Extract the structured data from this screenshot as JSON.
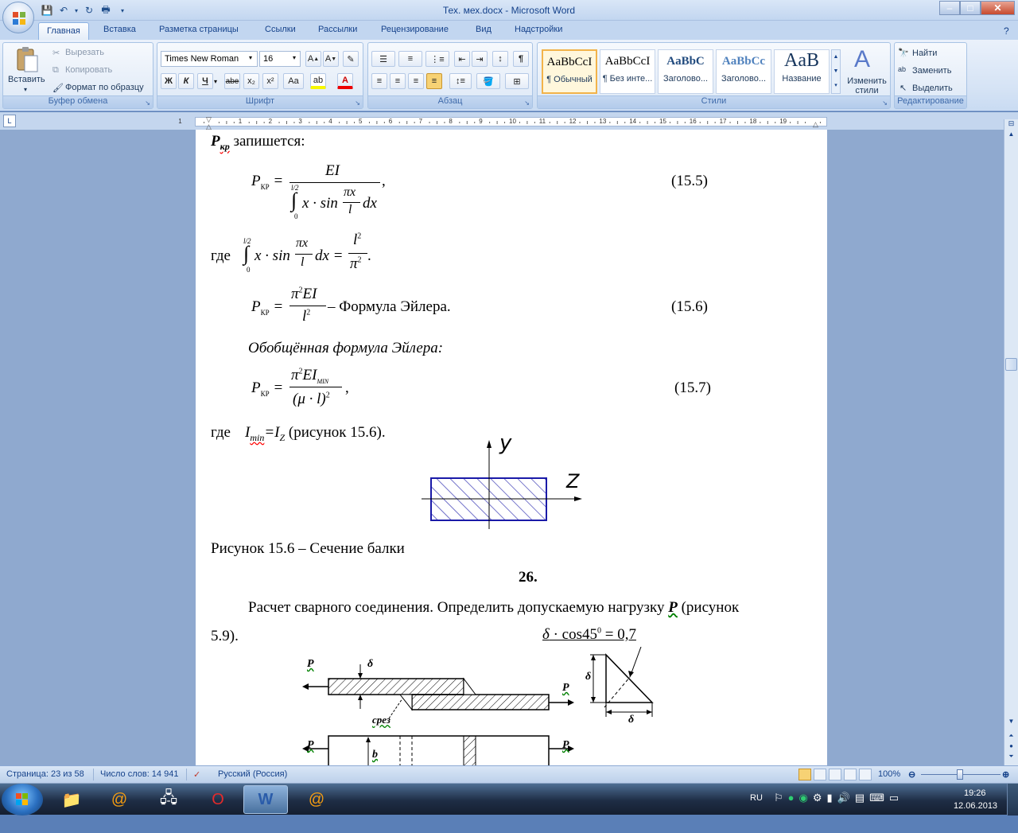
{
  "window": {
    "title": "Тех. мех.docx - Microsoft Word"
  },
  "tabs": [
    "Главная",
    "Вставка",
    "Разметка страницы",
    "Ссылки",
    "Рассылки",
    "Рецензирование",
    "Вид",
    "Надстройки"
  ],
  "ribbon": {
    "clipboard": {
      "label": "Буфер обмена",
      "paste": "Вставить",
      "cut": "Вырезать",
      "copy": "Копировать",
      "format_painter": "Формат по образцу"
    },
    "font": {
      "label": "Шрифт",
      "family": "Times New Roman",
      "size": "16",
      "bold": "Ж",
      "italic": "К",
      "underline": "Ч",
      "strike": "abe",
      "sub": "x₂",
      "sup": "x²",
      "case": "Aa"
    },
    "paragraph": {
      "label": "Абзац",
      "pilcrow": "¶"
    },
    "styles": {
      "label": "Стили",
      "items": [
        {
          "sample": "AaBbCcI",
          "name": "¶ Обычный"
        },
        {
          "sample": "AaBbCcI",
          "name": "¶ Без инте..."
        },
        {
          "sample": "AaBbC",
          "name": "Заголово..."
        },
        {
          "sample": "AaBbCc",
          "name": "Заголово..."
        },
        {
          "sample": "AaB",
          "name": "Название"
        }
      ],
      "change_styles": "Изменить стили"
    },
    "editing": {
      "label": "Редактирование",
      "find": "Найти",
      "replace": "Заменить",
      "select": "Выделить"
    }
  },
  "ruler": {
    "numbers": [
      "1",
      "1",
      "2",
      "3",
      "4",
      "5",
      "6",
      "7",
      "8",
      "9",
      "10",
      "11",
      "12",
      "13",
      "14",
      "15",
      "16",
      "17",
      "18",
      "19"
    ]
  },
  "document": {
    "line1_sym": "P",
    "line1_sub": "кр",
    "line1_text": " запишется:",
    "f155_lhs": "P",
    "f155_lhs_sub": "КР",
    "f155_num": "EI",
    "f155_lim_top": "l/2",
    "f155_lim_bot": "0",
    "f155_den": "x · sin",
    "f155_pix": "πx",
    "f155_l": "l",
    "f155_dx": "dx",
    "f155_comma": ",",
    "f155_tag": "(15.5)",
    "where1": "где",
    "w_lim_top": "l/2",
    "w_lim_bot": "0",
    "w_expr": "x · sin",
    "w_pix": "πx",
    "w_l": "l",
    "w_dx": "dx =",
    "w_l2": "l",
    "w_l2_exp": "2",
    "w_pi2": "π",
    "w_pi2_exp": "2",
    "w_dot": ".",
    "f156_lhs": "P",
    "f156_lhs_sub": "КР",
    "f156_num": "π",
    "f156_num_exp": "2",
    "f156_num2": "EI",
    "f156_den": "l",
    "f156_den_exp": "2",
    "f156_text": "– Формула Эйлера.",
    "f156_tag": "(15.6)",
    "general": "Обобщённая формула Эйлера:",
    "f157_lhs": "P",
    "f157_lhs_sub": "КР",
    "f157_num": "π",
    "f157_num_exp": "2",
    "f157_num2": "EI",
    "f157_num_sub": "MIN",
    "f157_den": "(μ · l)",
    "f157_den_exp": "2",
    "f157_comma": ",",
    "f157_tag": "(15.7)",
    "where2": "где",
    "imin": "I",
    "imin_sub": "min",
    "imin_eq": "=I",
    "imin_z": "Z",
    "imin_ref": " (рисунок 15.6).",
    "axis_y": "y",
    "axis_z": "Z",
    "fig_caption": "Рисунок 15.6 – Сечение  балки",
    "problem_no": "26.",
    "para1": "Расчет  сварного  соединения.  Определить  допускаемую  нагрузку",
    "para1_P": "P",
    "para1_end": "(рисунок",
    "para2": "5.9).",
    "weld_formula": "δ · cos45° = 0,7",
    "lbl_P1": "P",
    "lbl_P2": "P",
    "lbl_P3": "P",
    "lbl_P4": "P",
    "lbl_delta1": "δ",
    "lbl_delta2": "δ",
    "lbl_delta3": "δ",
    "lbl_srez": "срез",
    "lbl_b": "b"
  },
  "statusbar": {
    "page": "Страница: 23 из 58",
    "words": "Число слов: 14 941",
    "lang": "Русский (Россия)",
    "zoom": "100%"
  },
  "taskbar": {
    "lang": "RU",
    "time": "19:26",
    "date": "12.06.2013"
  }
}
